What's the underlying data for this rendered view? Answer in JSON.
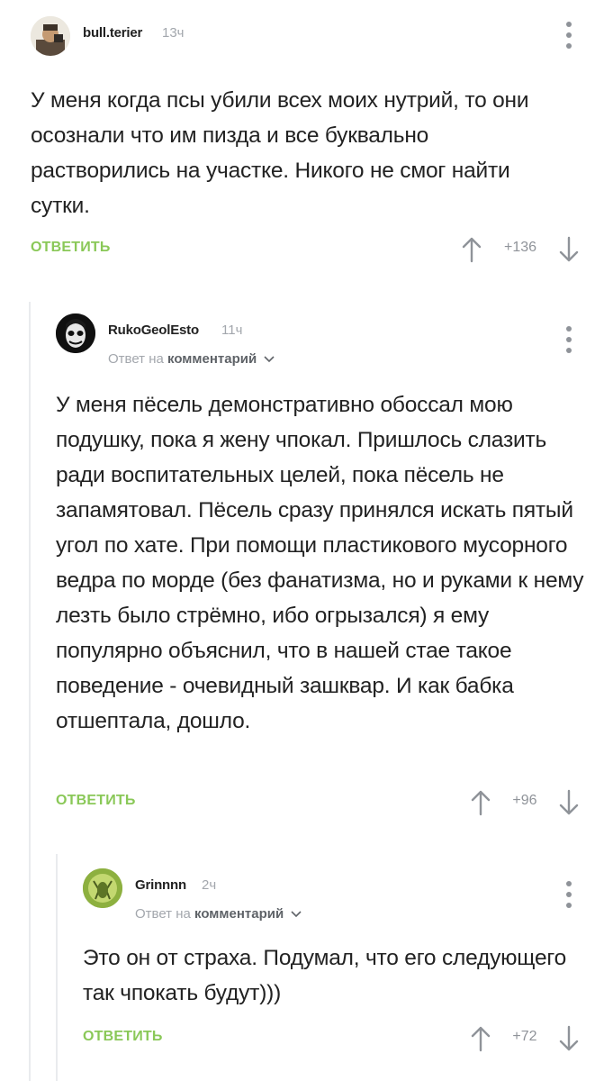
{
  "comments": [
    {
      "username": "bull.terier",
      "time": "13ч",
      "text": "У меня когда псы убили всех моих нутрий, то они осознали что им пизда и все буквально растворились на участке. Никого не смог найти сутки.",
      "reply_label": "ОТВЕТИТЬ",
      "rating": "+136"
    },
    {
      "username": "RukoGeolEsto",
      "time": "11ч",
      "reply_prefix": "Ответ на",
      "reply_target": "комментарий",
      "text": "У меня пёсель демонстративно обоссал мою подушку, пока я жену чпокал. Пришлось слазить ради воспитательных целей, пока пёсель не запамятовал. Пёсель сразу принялся искать пятый угол по хате. При помощи пластикового мусорного ведра по морде (без фанатизма, но и руками к нему лезть было стрёмно, ибо огрызался) я ему популярно объяснил, что в нашей стае такое поведение - очевидный зашквар. И как бабка отшептала, дошло.",
      "reply_label": "ОТВЕТИТЬ",
      "rating": "+96"
    },
    {
      "username": "Grinnnn",
      "time": "2ч",
      "reply_prefix": "Ответ на",
      "reply_target": "комментарий",
      "text": "Это он от страха. Подумал, что его следующего так чпокать будут)))",
      "reply_label": "ОТВЕТИТЬ",
      "rating": "+72"
    }
  ],
  "icons": {
    "up": "arrow-up-icon",
    "down": "arrow-down-icon",
    "more": "more-vertical-icon",
    "chevron": "chevron-down-icon"
  },
  "colors": {
    "reply_green": "#8ac858",
    "muted": "#a3a7ad",
    "thread_line": "#e9ebee"
  }
}
